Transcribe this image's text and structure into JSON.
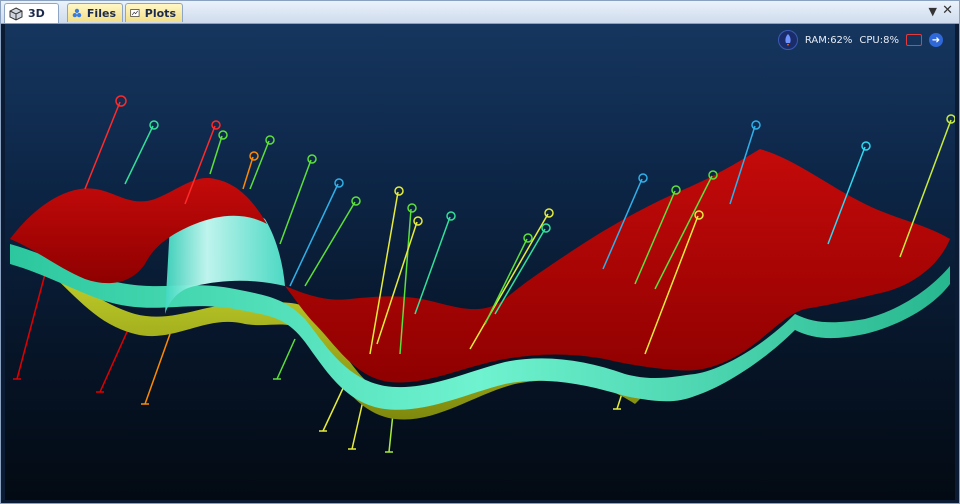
{
  "tabs": [
    {
      "label": "3D",
      "icon": "cube-icon",
      "active": true
    },
    {
      "label": "Files",
      "icon": "files-icon",
      "active": false
    },
    {
      "label": "Plots",
      "icon": "plots-icon",
      "active": false
    }
  ],
  "status": {
    "ram": "RAM:62%",
    "cpu": "CPU:8%"
  },
  "colors": {
    "surface_top": "#b00000",
    "surface_edge": "#35d9b0",
    "surface_under": "#a8b81e",
    "background": "#0b2142"
  }
}
